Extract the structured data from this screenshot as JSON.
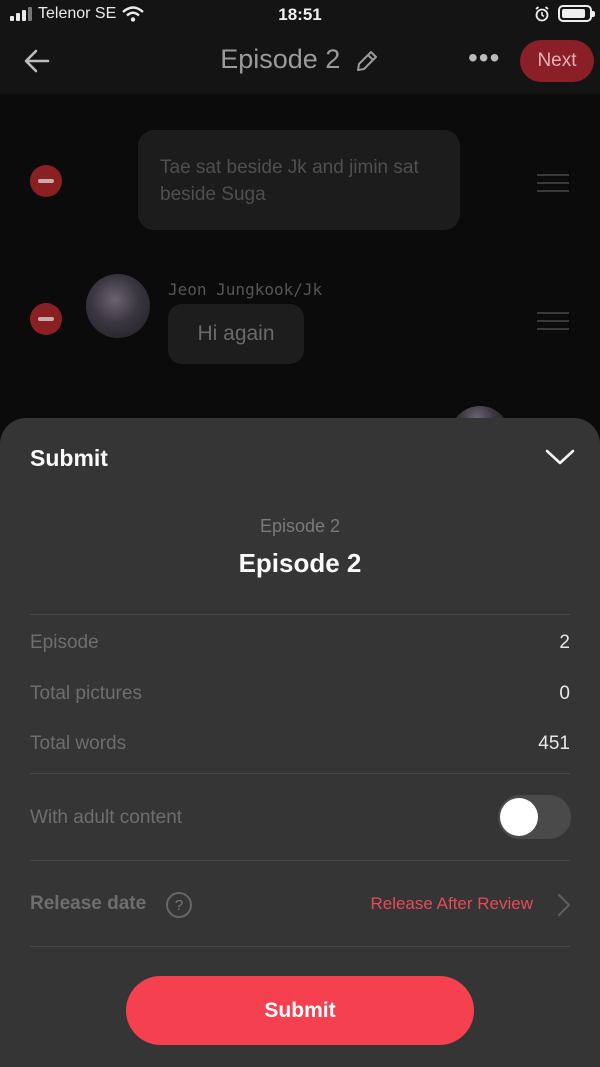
{
  "status_bar": {
    "carrier": "Telenor SE",
    "time": "18:51"
  },
  "header": {
    "title": "Episode 2",
    "next_label": "Next"
  },
  "editor": {
    "narration": "Tae sat beside Jk and jimin sat beside Suga",
    "character_name": "Jeon Jungkook/Jk",
    "message": "Hi again"
  },
  "sheet": {
    "title": "Submit",
    "episode_subtitle": "Episode 2",
    "episode_title": "Episode 2",
    "stats": [
      {
        "label": "Episode",
        "value": "2"
      },
      {
        "label": "Total pictures",
        "value": "0"
      },
      {
        "label": "Total words",
        "value": "451"
      }
    ],
    "adult_content_label": "With adult content",
    "adult_content_enabled": false,
    "release_label": "Release date",
    "help_glyph": "?",
    "release_value": "Release After Review",
    "submit_label": "Submit"
  },
  "colors": {
    "accent": "#f5404f",
    "sheet_bg": "#353535",
    "release_text": "#e54a5a"
  }
}
